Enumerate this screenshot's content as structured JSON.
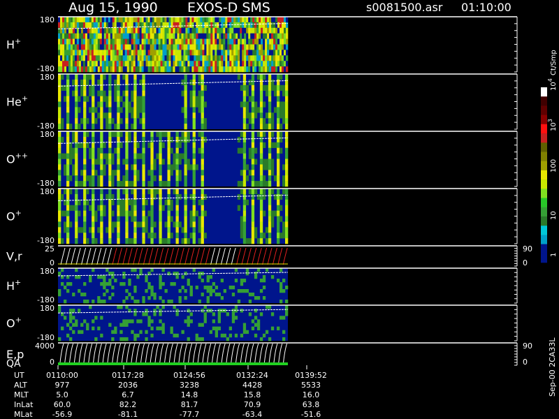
{
  "header": {
    "date": "Aug 15, 1990",
    "instrument": "EXOS-D SMS",
    "file": "s0081500.asr",
    "time": "01:10:00"
  },
  "colorbar": {
    "unit": "Ct/Smp",
    "ticks": [
      "1",
      "10",
      "100",
      "10",
      "10"
    ],
    "tick_exponents": [
      "",
      "",
      "",
      "3",
      "4"
    ],
    "colors": [
      "#00158c",
      "#00158c",
      "#00a0c8",
      "#00c8d8",
      "#2a7a2a",
      "#35a035",
      "#28c828",
      "#80e020",
      "#c8e800",
      "#e8e800",
      "#a0a000",
      "#808000",
      "#606000",
      "#c82020",
      "#ff1010",
      "#8a0000",
      "#600000",
      "#400000",
      "#ffffff"
    ]
  },
  "side_label": "Sep-00 2CA33L",
  "chart_data": {
    "type": "heatmap",
    "panels": [
      {
        "name": "H",
        "sup": "+",
        "ytop": "180",
        "ybot": "-180",
        "pattern": "h_dense"
      },
      {
        "name": "He",
        "sup": "+",
        "ytop": "180",
        "ybot": "-180",
        "pattern": "stripes"
      },
      {
        "name": "O",
        "sup": "++",
        "ytop": "180",
        "ybot": "-180",
        "pattern": "stripes"
      },
      {
        "name": "O",
        "sup": "+",
        "ytop": "180",
        "ybot": "-180",
        "pattern": "stripes"
      },
      {
        "name": "V,r",
        "sup": "",
        "ytop": "25",
        "ybot": "0",
        "right_top": "90",
        "right_bot": "0",
        "pattern": "vr"
      },
      {
        "name": "H",
        "sup": "+",
        "ytop": "180",
        "ybot": "-180",
        "pattern": "sparse"
      },
      {
        "name": "O",
        "sup": "+",
        "ytop": "180",
        "ybot": "-180",
        "pattern": "sparse"
      },
      {
        "name": "E,p",
        "sup": "",
        "name2": "QA",
        "ytop": "4000",
        "ybot": "0",
        "right_top": "90",
        "right_bot": "0",
        "pattern": "ep"
      }
    ],
    "time_axis": {
      "row_labels": [
        "UT",
        "ALT",
        "MLT",
        "InLat",
        "MLat"
      ],
      "columns": [
        [
          "0110:00",
          "977",
          "5.0",
          "60.0",
          "-56.9"
        ],
        [
          "0117:28",
          "2036",
          "6.7",
          "82.2",
          "-81.1"
        ],
        [
          "0124:56",
          "3238",
          "14.8",
          "81.7",
          "-77.7"
        ],
        [
          "0132:24",
          "4428",
          "15.8",
          "70.9",
          "-63.4"
        ],
        [
          "0139:52",
          "5533",
          "16.0",
          "63.8",
          "-51.6"
        ]
      ]
    },
    "data_fraction": 0.5
  }
}
